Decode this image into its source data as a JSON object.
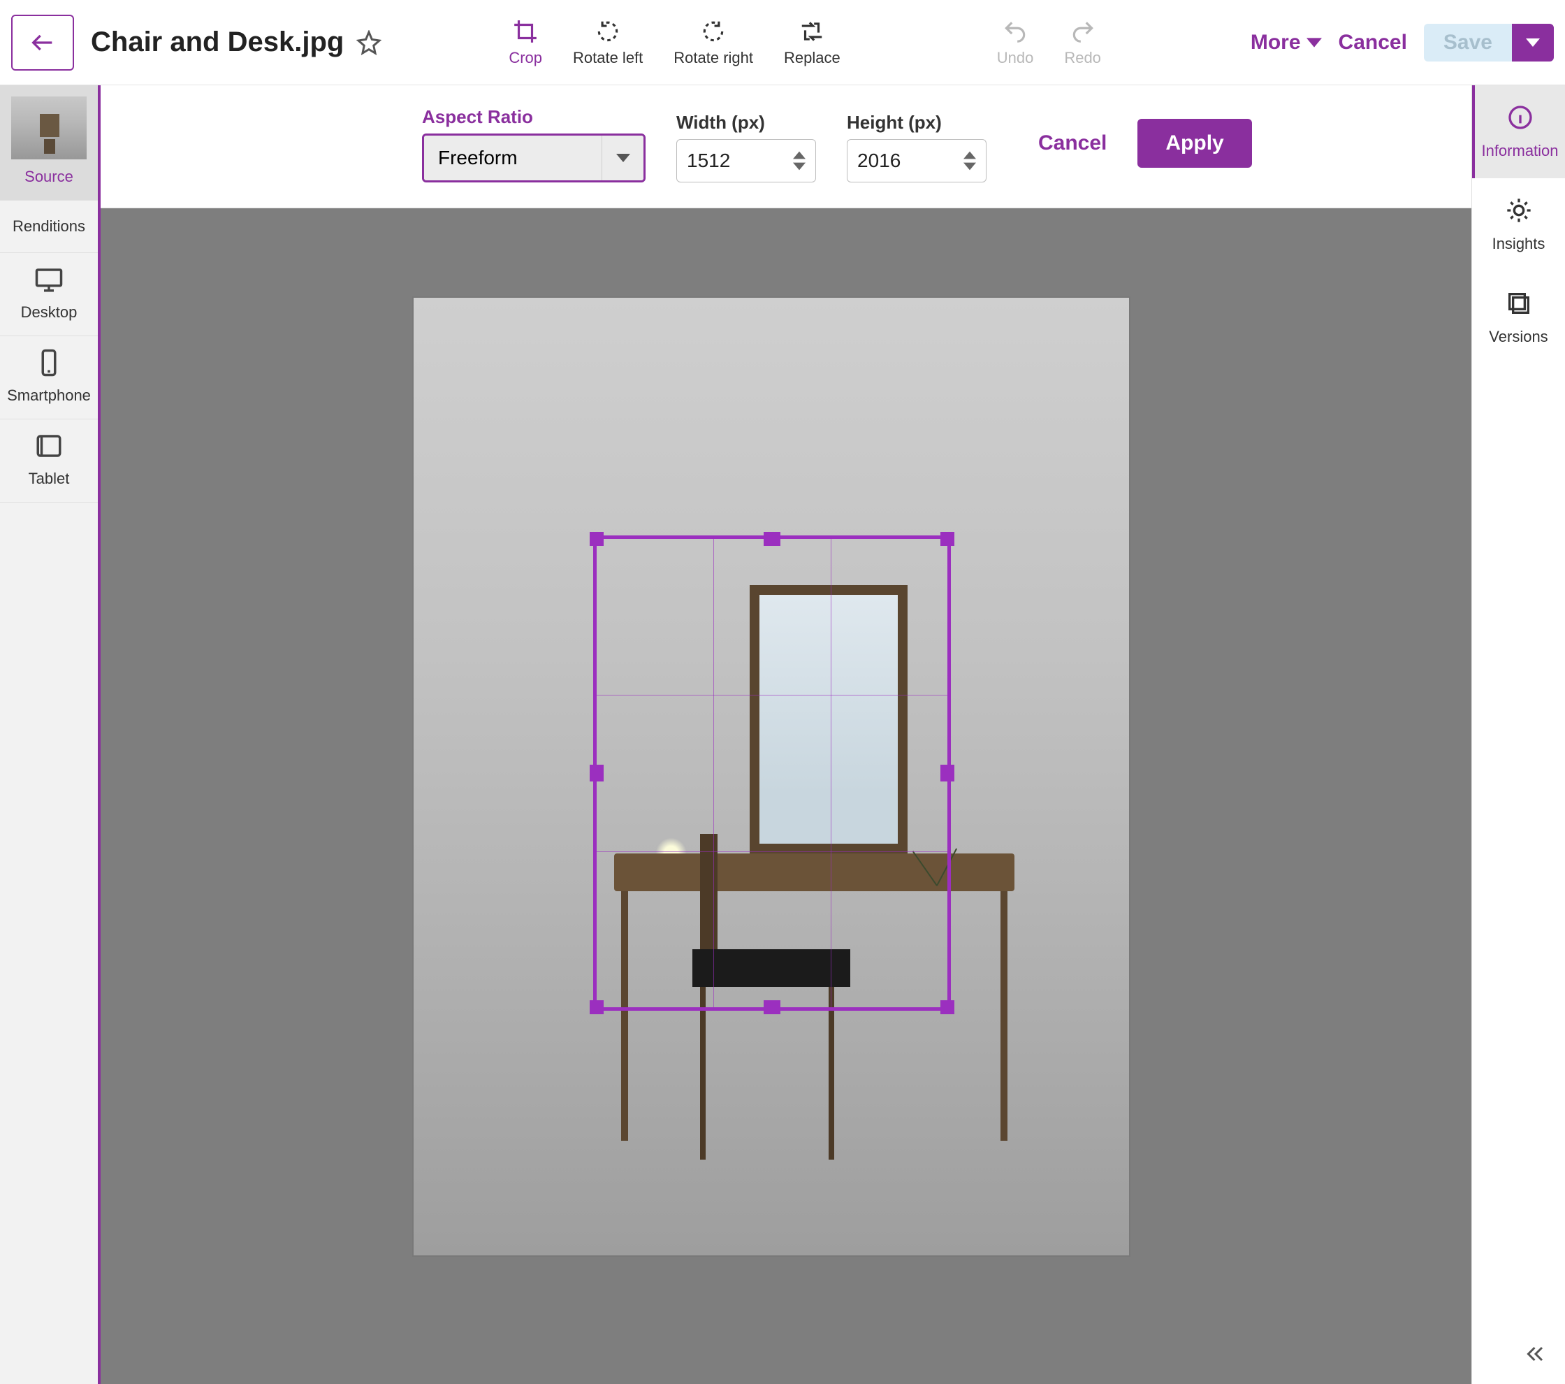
{
  "header": {
    "title": "Chair and Desk.jpg"
  },
  "toolbar": {
    "crop": "Crop",
    "rotate_left": "Rotate left",
    "rotate_right": "Rotate right",
    "replace": "Replace",
    "undo": "Undo",
    "redo": "Redo",
    "more": "More",
    "cancel": "Cancel",
    "save": "Save"
  },
  "crop_panel": {
    "aspect_label": "Aspect Ratio",
    "aspect_value": "Freeform",
    "width_label": "Width (px)",
    "width_value": "1512",
    "height_label": "Height (px)",
    "height_value": "2016",
    "cancel": "Cancel",
    "apply": "Apply"
  },
  "left_rail": {
    "source": "Source",
    "renditions": "Renditions",
    "desktop": "Desktop",
    "smartphone": "Smartphone",
    "tablet": "Tablet"
  },
  "right_rail": {
    "information": "Information",
    "insights": "Insights",
    "versions": "Versions"
  }
}
